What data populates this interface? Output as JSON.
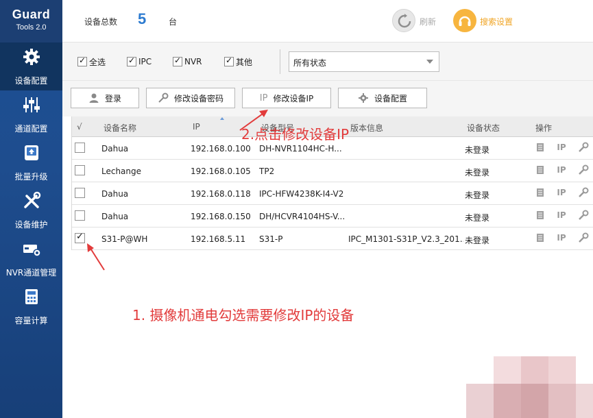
{
  "sidebar": {
    "logo_line1": "Guard",
    "logo_line2": "Tools 2.0",
    "items": [
      {
        "label": "设备配置",
        "icon": "gear-icon"
      },
      {
        "label": "通道配置",
        "icon": "sliders-icon"
      },
      {
        "label": "批量升级",
        "icon": "upgrade-icon"
      },
      {
        "label": "设备维护",
        "icon": "tools-icon"
      },
      {
        "label": "NVR通道管理",
        "icon": "nvr-icon"
      },
      {
        "label": "容量计算",
        "icon": "calculator-icon"
      }
    ]
  },
  "topbar": {
    "count_label": "设备总数",
    "count_value": "5",
    "count_unit": "台",
    "refresh_label": "刷新",
    "search_settings_label": "搜索设置"
  },
  "filters": {
    "all_label": "全选",
    "ipc_label": "IPC",
    "nvr_label": "NVR",
    "other_label": "其他",
    "status_select": "所有状态"
  },
  "actions": {
    "login": "登录",
    "change_password": "修改设备密码",
    "change_ip": "修改设备IP",
    "ip_glyph": "IP",
    "device_config": "设备配置"
  },
  "table": {
    "headers": {
      "check": "√",
      "name": "设备名称",
      "ip": "IP",
      "model": "设备型号",
      "version": "版本信息",
      "status": "设备状态",
      "ops": "操作"
    },
    "op_ip_glyph": "IP",
    "rows": [
      {
        "checked": false,
        "name": "Dahua",
        "ip": "192.168.0.100",
        "model": "DH-NVR1104HC-H...",
        "version": "",
        "status": "未登录"
      },
      {
        "checked": false,
        "name": "Lechange",
        "ip": "192.168.0.105",
        "model": "TP2",
        "version": "",
        "status": "未登录"
      },
      {
        "checked": false,
        "name": "Dahua",
        "ip": "192.168.0.118",
        "model": "IPC-HFW4238K-I4-V2",
        "version": "",
        "status": "未登录"
      },
      {
        "checked": false,
        "name": "Dahua",
        "ip": "192.168.0.150",
        "model": "DH/HCVR4104HS-V...",
        "version": "",
        "status": "未登录"
      },
      {
        "checked": true,
        "name": "S31-P@WH",
        "ip": "192.168.5.11",
        "model": "S31-P",
        "version": "IPC_M1301-S31P_V2.3_201...",
        "status": "未登录"
      }
    ]
  },
  "annotations": {
    "step2": "2.点击修改设备IP",
    "step1": "1. 摄像机通电勾选需要修改IP的设备",
    "color": "#e23b3b"
  }
}
